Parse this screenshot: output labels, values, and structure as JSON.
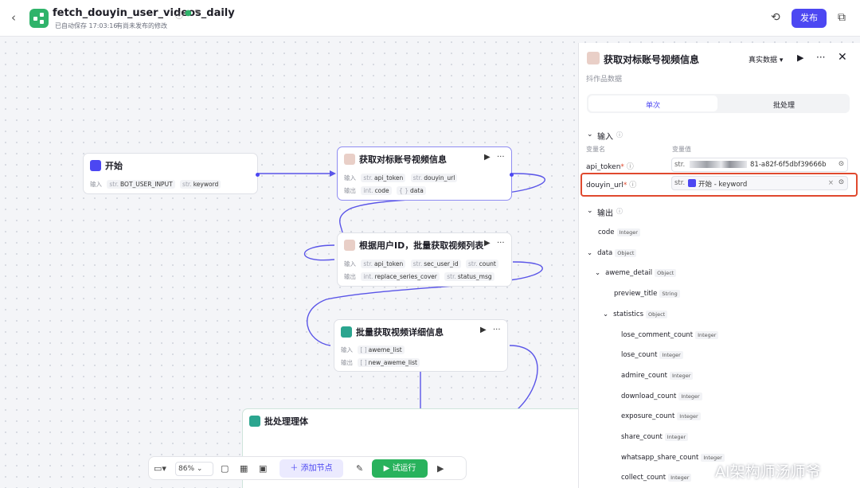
{
  "topbar": {
    "back_icon": "chevron-left-icon",
    "title": "fetch_douyin_user_videos_daily",
    "autosave": "已自动保存 17:03:16",
    "unpublished": "有尚未发布的修改",
    "publish_label": "发布",
    "accent": "#4c47f2"
  },
  "nodes": {
    "start": {
      "title": "开始",
      "input_label": "输入",
      "inputs": [
        {
          "type": "str.",
          "name": "BOT_USER_INPUT"
        },
        {
          "type": "str.",
          "name": "keyword"
        }
      ]
    },
    "get_account": {
      "title": "获取对标账号视频信息",
      "input_label": "输入",
      "output_label": "输出",
      "inputs": [
        {
          "type": "str.",
          "name": "api_token"
        },
        {
          "type": "str.",
          "name": "douyin_url"
        }
      ],
      "outputs": [
        {
          "type": "int.",
          "name": "code"
        },
        {
          "type": "{ }",
          "name": "data"
        }
      ]
    },
    "batch_list": {
      "title": "根据用户ID，批量获取视频列表",
      "input_label": "输入",
      "output_label": "输出",
      "inputs": [
        {
          "type": "str.",
          "name": "api_token"
        },
        {
          "type": "str.",
          "name": "sec_user_id"
        },
        {
          "type": "str.",
          "name": "count"
        }
      ],
      "outputs": [
        {
          "type": "int.",
          "name": "replace_series_cover"
        },
        {
          "type": "str.",
          "name": "status_msg"
        }
      ],
      "more": "···"
    },
    "batch_detail": {
      "title": "批量获取视频详细信息",
      "input_label": "输入",
      "output_label": "输出",
      "inputs": [
        {
          "type": "[ ]",
          "name": "aweme_list"
        }
      ],
      "outputs": [
        {
          "type": "[ ]",
          "name": "new_aweme_list"
        }
      ]
    },
    "batch_body": {
      "title": "批处理理体"
    }
  },
  "panel": {
    "title": "获取对标账号视频信息",
    "mode": "真实数据",
    "subtitle": "抖作品数据",
    "tabs": [
      "单次",
      "批处理"
    ],
    "input_section": "输入",
    "col_name": "变量名",
    "col_value": "变量值",
    "params": [
      {
        "name": "api_token",
        "required": "*",
        "type": "str.",
        "value": "81-a82f-6f5dbf39666b"
      },
      {
        "name": "douyin_url",
        "required": "*",
        "type": "str.",
        "ref_node": "开始",
        "ref_var": "keyword"
      }
    ],
    "output_section": "输出",
    "outputs": [
      {
        "name": "code",
        "type": "Integer",
        "level": 0,
        "caret": ""
      },
      {
        "name": "data",
        "type": "Object",
        "level": 0,
        "caret": "⌄"
      },
      {
        "name": "aweme_detail",
        "type": "Object",
        "level": 1,
        "caret": "⌄"
      },
      {
        "name": "preview_title",
        "type": "String",
        "level": 2,
        "caret": ""
      },
      {
        "name": "statistics",
        "type": "Object",
        "level": 2,
        "caret": "⌄"
      },
      {
        "name": "lose_comment_count",
        "type": "Integer",
        "level": 3,
        "caret": ""
      },
      {
        "name": "lose_count",
        "type": "Integer",
        "level": 3,
        "caret": ""
      },
      {
        "name": "admire_count",
        "type": "Integer",
        "level": 3,
        "caret": ""
      },
      {
        "name": "download_count",
        "type": "Integer",
        "level": 3,
        "caret": ""
      },
      {
        "name": "exposure_count",
        "type": "Integer",
        "level": 3,
        "caret": ""
      },
      {
        "name": "share_count",
        "type": "Integer",
        "level": 3,
        "caret": ""
      },
      {
        "name": "whatsapp_share_count",
        "type": "Integer",
        "level": 3,
        "caret": ""
      },
      {
        "name": "collect_count",
        "type": "Integer",
        "level": 3,
        "caret": ""
      }
    ],
    "highlight_color": "#e0492e"
  },
  "bottombar": {
    "zoom": "86%",
    "add_node": "添加节点",
    "run": "试运行"
  },
  "watermark": "AI架构师汤师爷"
}
